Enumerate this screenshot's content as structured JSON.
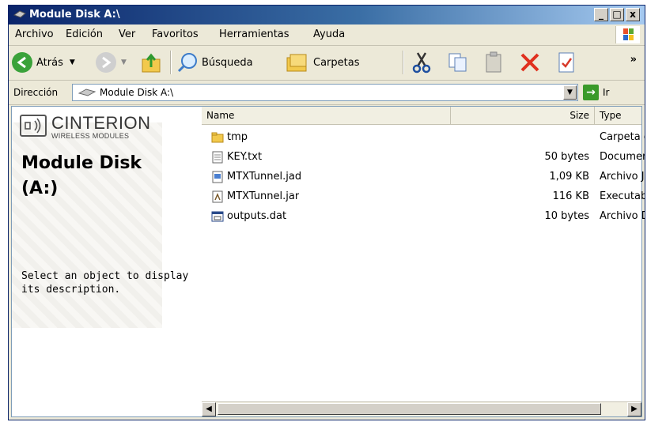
{
  "window": {
    "title": "Module Disk A:\\"
  },
  "titlebar": {
    "minimize": "_",
    "maximize": "□",
    "close": "x"
  },
  "menu": [
    "Archivo",
    "Edición",
    "Ver",
    "Favoritos",
    "Herramientas",
    "Ayuda"
  ],
  "toolbar": {
    "back_label": "Atrás",
    "search_label": "Búsqueda",
    "folders_label": "Carpetas",
    "overflow": "»"
  },
  "address": {
    "label": "Dirección",
    "value": "Module Disk A:\\",
    "go_label": "Ir"
  },
  "leftpane": {
    "brand": "CINTERION",
    "brand_sub": "WIRELESS MODULES",
    "drive_title": "Module Disk (A:)",
    "description": "Select an object to display its description."
  },
  "columns": {
    "name": "Name",
    "size": "Size",
    "type": "Type"
  },
  "files": [
    {
      "name": "tmp",
      "size": "",
      "type": "Carpeta d",
      "icon": "folder-icon"
    },
    {
      "name": "KEY.txt",
      "size": "50 bytes",
      "type": "Documen",
      "icon": "text-file-icon"
    },
    {
      "name": "MTXTunnel.jad",
      "size": "1,09 KB",
      "type": "Archivo J",
      "icon": "jad-file-icon"
    },
    {
      "name": "MTXTunnel.jar",
      "size": "116 KB",
      "type": "Executab",
      "icon": "jar-file-icon"
    },
    {
      "name": "outputs.dat",
      "size": "10 bytes",
      "type": "Archivo D",
      "icon": "dat-file-icon"
    }
  ]
}
